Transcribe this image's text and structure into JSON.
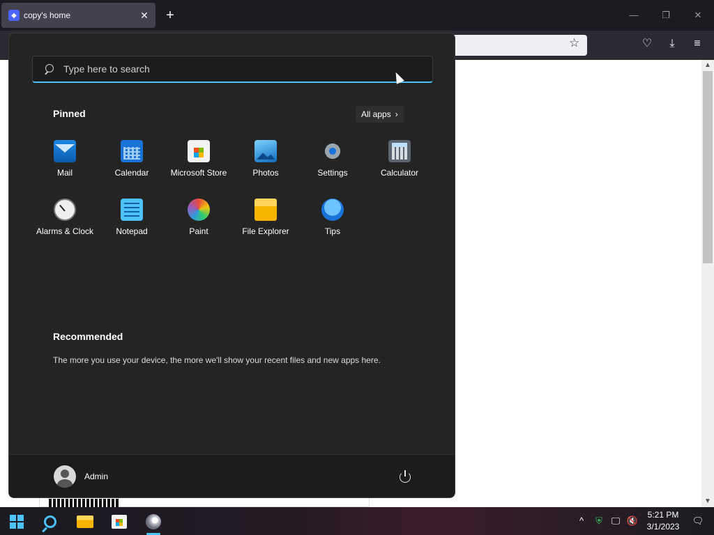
{
  "browser": {
    "tab_title": "copy's home",
    "tab_close": "✕",
    "new_tab": "+",
    "window_controls": {
      "minimize": "—",
      "restore": "❐",
      "close": "✕"
    },
    "bookmark_star": "☆",
    "nav_icons": {
      "pocket": "♡",
      "downloads": "⤓",
      "menu": "≡"
    }
  },
  "start_menu": {
    "search": {
      "placeholder": "Type here to search"
    },
    "pinned_title": "Pinned",
    "all_apps_label": "All apps",
    "all_apps_chevron": "›",
    "pinned_apps": [
      {
        "label": "Mail",
        "icon": "mail-icon"
      },
      {
        "label": "Calendar",
        "icon": "calendar-icon"
      },
      {
        "label": "Microsoft Store",
        "icon": "store-icon"
      },
      {
        "label": "Photos",
        "icon": "photos-icon"
      },
      {
        "label": "Settings",
        "icon": "settings-icon"
      },
      {
        "label": "Calculator",
        "icon": "calculator-icon"
      },
      {
        "label": "Alarms & Clock",
        "icon": "clock-icon"
      },
      {
        "label": "Notepad",
        "icon": "notepad-icon"
      },
      {
        "label": "Paint",
        "icon": "paint-icon"
      },
      {
        "label": "File Explorer",
        "icon": "folder-icon"
      },
      {
        "label": "Tips",
        "icon": "tips-icon"
      }
    ],
    "recommended_title": "Recommended",
    "recommended_text": "The more you use your device, the more we'll show your recent files and new apps here.",
    "user_name": "Admin"
  },
  "taskbar": {
    "tray": {
      "chevron": "^",
      "network": "🖵",
      "notifications": "🗨"
    },
    "time": "5:21 PM",
    "date": "3/1/2023"
  },
  "colors": {
    "accent": "#4cc2ff",
    "start_bg": "#242424",
    "browser_chrome": "#1c1b22"
  }
}
